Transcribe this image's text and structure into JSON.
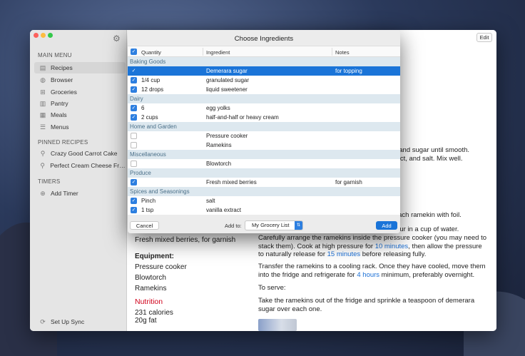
{
  "window": {
    "edit_label": "Edit"
  },
  "sidebar": {
    "main_menu_header": "MAIN MENU",
    "menu": [
      {
        "label": "Recipes",
        "icon": "book-icon",
        "active": true
      },
      {
        "label": "Browser",
        "icon": "globe-icon"
      },
      {
        "label": "Groceries",
        "icon": "basket-icon"
      },
      {
        "label": "Pantry",
        "icon": "pantry-icon"
      },
      {
        "label": "Meals",
        "icon": "calendar-icon"
      },
      {
        "label": "Menus",
        "icon": "list-icon"
      }
    ],
    "pinned_header": "PINNED RECIPES",
    "pinned": [
      {
        "label": "Crazy Good Carrot Cake",
        "icon": "pin-icon"
      },
      {
        "label": "Perfect Cream Cheese Fros...",
        "icon": "pin-icon"
      }
    ],
    "timers_header": "TIMERS",
    "add_timer": "Add Timer",
    "sync": "Set Up Sync"
  },
  "recipe": {
    "left": {
      "garnish_line": "Fresh mixed berries, for garnish",
      "equipment_header": "Equipment:",
      "equipment": [
        "Pressure cooker",
        "Blowtorch",
        "Ramekins"
      ],
      "nutrition_link": "Nutrition",
      "calories": "231 calories",
      "fat": "20g fat"
    },
    "right": {
      "frag1": "lks and sugar until smooth.",
      "frag2": "xtract, and salt. Mix well.",
      "frag3": "ver each ramekin with foil.",
      "frag4": "l pour in a cup of water.",
      "para_a": "Carefully arrange the ramekins inside the pressure cooker (you may need to stack them). Cook at high pressure for ",
      "time1": "10 minutes",
      "para_b": ", then allow the pressure to naturally release for ",
      "time2": "15 minutes",
      "para_c": " before releasing fully.",
      "para2_a": "Transfer the ramekins to a cooling rack. Once they have cooled, move them into the fridge and refrigerate for ",
      "time3": "4 hours",
      "para2_b": " minimum, preferably overnight.",
      "serve_header": "To serve:",
      "serve_text": "Take the ramekins out of the fridge and sprinkle a teaspoon of demerara sugar over each one."
    }
  },
  "sheet": {
    "title": "Choose Ingredients",
    "columns": {
      "quantity": "Quantity",
      "ingredient": "Ingredient",
      "notes": "Notes"
    },
    "rows": [
      {
        "group": "Baking Goods"
      },
      {
        "checked": true,
        "selected": true,
        "qty": "",
        "ingredient": "Demerara sugar",
        "notes": "for topping"
      },
      {
        "checked": true,
        "qty": "1/4 cup",
        "ingredient": "granulated sugar",
        "notes": ""
      },
      {
        "checked": true,
        "qty": "12 drops",
        "ingredient": "liquid sweetener",
        "notes": ""
      },
      {
        "group": "Dairy"
      },
      {
        "checked": true,
        "qty": "6",
        "ingredient": "egg yolks",
        "notes": ""
      },
      {
        "checked": true,
        "qty": "2 cups",
        "ingredient": "half-and-half or heavy cream",
        "notes": ""
      },
      {
        "group": "Home and Garden"
      },
      {
        "checked": false,
        "qty": "",
        "ingredient": "Pressure cooker",
        "notes": ""
      },
      {
        "checked": false,
        "qty": "",
        "ingredient": "Ramekins",
        "notes": ""
      },
      {
        "group": "Miscellaneous"
      },
      {
        "checked": false,
        "qty": "",
        "ingredient": "Blowtorch",
        "notes": ""
      },
      {
        "group": "Produce"
      },
      {
        "checked": true,
        "qty": "",
        "ingredient": "Fresh mixed berries",
        "notes": "for garnish"
      },
      {
        "group": "Spices and Seasonings"
      },
      {
        "checked": true,
        "qty": "Pinch",
        "ingredient": "salt",
        "notes": ""
      },
      {
        "checked": true,
        "qty": "1 tsp",
        "ingredient": "vanilla extract",
        "notes": ""
      }
    ],
    "cancel_label": "Cancel",
    "add_to_label": "Add to:",
    "list_value": "My Grocery List",
    "add_label": "Add"
  },
  "colors": {
    "accent": "#1a74d8",
    "group_bg": "#dde8ef",
    "nutrition": "#d0021b"
  }
}
